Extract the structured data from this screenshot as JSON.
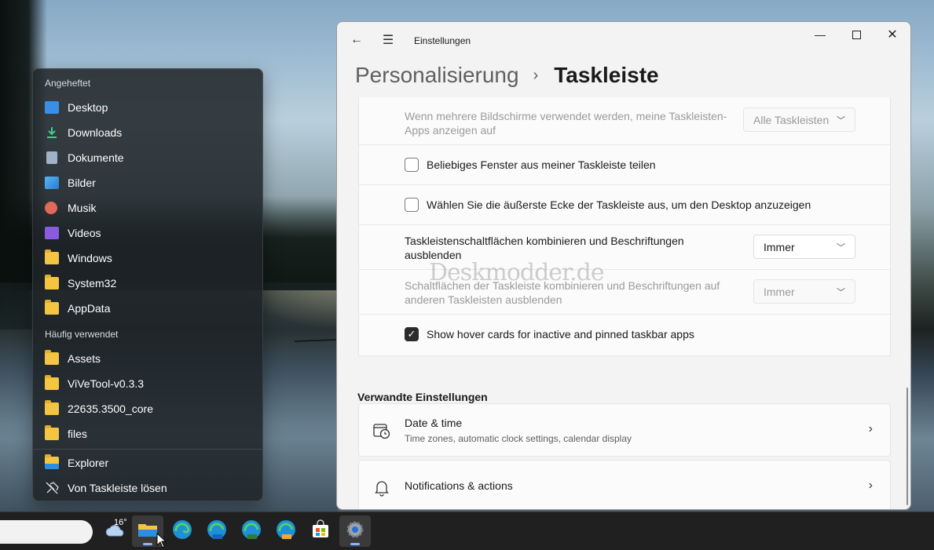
{
  "jumplist": {
    "pinned_header": "Angeheftet",
    "pinned": [
      {
        "label": "Desktop",
        "icon": "desktop-icon"
      },
      {
        "label": "Downloads",
        "icon": "download-icon"
      },
      {
        "label": "Dokumente",
        "icon": "document-icon"
      },
      {
        "label": "Bilder",
        "icon": "pictures-icon"
      },
      {
        "label": "Musik",
        "icon": "music-icon"
      },
      {
        "label": "Videos",
        "icon": "videos-icon"
      },
      {
        "label": "Windows",
        "icon": "folder-icon"
      },
      {
        "label": "System32",
        "icon": "folder-icon"
      },
      {
        "label": "AppData",
        "icon": "folder-icon"
      }
    ],
    "frequent_header": "Häufig verwendet",
    "frequent": [
      {
        "label": "Assets",
        "icon": "folder-icon"
      },
      {
        "label": "ViVeTool-v0.3.3",
        "icon": "folder-icon"
      },
      {
        "label": "22635.3500_core",
        "icon": "folder-icon"
      },
      {
        "label": "files",
        "icon": "folder-icon"
      }
    ],
    "actions": [
      {
        "label": "Explorer",
        "icon": "file-explorer-icon"
      },
      {
        "label": "Von Taskleiste lösen",
        "icon": "unpin-icon"
      }
    ]
  },
  "settings": {
    "window_title": "Einstellungen",
    "breadcrumb_parent": "Personalisierung",
    "breadcrumb_sep": "›",
    "breadcrumb_current": "Taskleiste",
    "rows": {
      "multi_display": {
        "label": "Wenn mehrere Bildschirme verwendet werden, meine Taskleisten-Apps anzeigen auf",
        "value": "Alle Taskleisten",
        "disabled": true
      },
      "share_window": {
        "label": "Beliebiges Fenster aus meiner Taskleiste teilen",
        "checked": false
      },
      "far_corner": {
        "label": "Wählen Sie die äußerste Ecke der Taskleiste aus, um den Desktop anzuzeigen",
        "checked": false
      },
      "combine": {
        "label": "Taskleistenschaltflächen kombinieren und Beschriftungen ausblenden",
        "value": "Immer"
      },
      "combine_other": {
        "label": "Schaltflächen der Taskleiste kombinieren und Beschriftungen auf anderen Taskleisten ausblenden",
        "value": "Immer",
        "disabled": true
      },
      "hover_cards": {
        "label": "Show hover cards for inactive and pinned taskbar apps",
        "checked": true
      }
    },
    "related_heading": "Verwandte Einstellungen",
    "related": [
      {
        "title": "Date & time",
        "subtitle": "Time zones, automatic clock settings, calendar display",
        "icon": "calendar-clock-icon"
      },
      {
        "title": "Notifications & actions",
        "subtitle": "",
        "icon": "bell-icon"
      }
    ]
  },
  "watermark": "Deskmodder.de",
  "taskbar": {
    "weather_temp": "16°",
    "apps": [
      "weather-icon",
      "file-explorer-icon",
      "edge-icon",
      "edge-beta-icon",
      "edge-dev-icon",
      "edge-canary-icon",
      "store-icon",
      "settings-icon"
    ]
  },
  "colors": {
    "accent": "#2b2b2b",
    "taskbar": "#202020",
    "window_bg": "#f3f3f3"
  }
}
